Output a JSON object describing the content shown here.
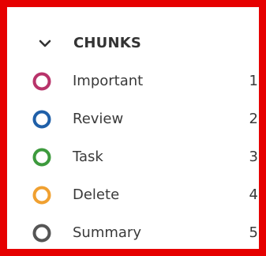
{
  "panel": {
    "title": "CHUNKS",
    "toggle_icon": "chevron-down-icon",
    "items": [
      {
        "label": "Important",
        "count": "1",
        "color": "#b8336a",
        "icon": "ring-icon"
      },
      {
        "label": "Review",
        "count": "2",
        "color": "#1f5fa8",
        "icon": "ring-icon"
      },
      {
        "label": "Task",
        "count": "3",
        "color": "#3d9a3d",
        "icon": "ring-icon"
      },
      {
        "label": "Delete",
        "count": "4",
        "color": "#f0a030",
        "icon": "ring-icon"
      },
      {
        "label": "Summary",
        "count": "5",
        "color": "#555555",
        "icon": "ring-icon"
      }
    ]
  },
  "frame": {
    "border_color": "#e60000"
  }
}
